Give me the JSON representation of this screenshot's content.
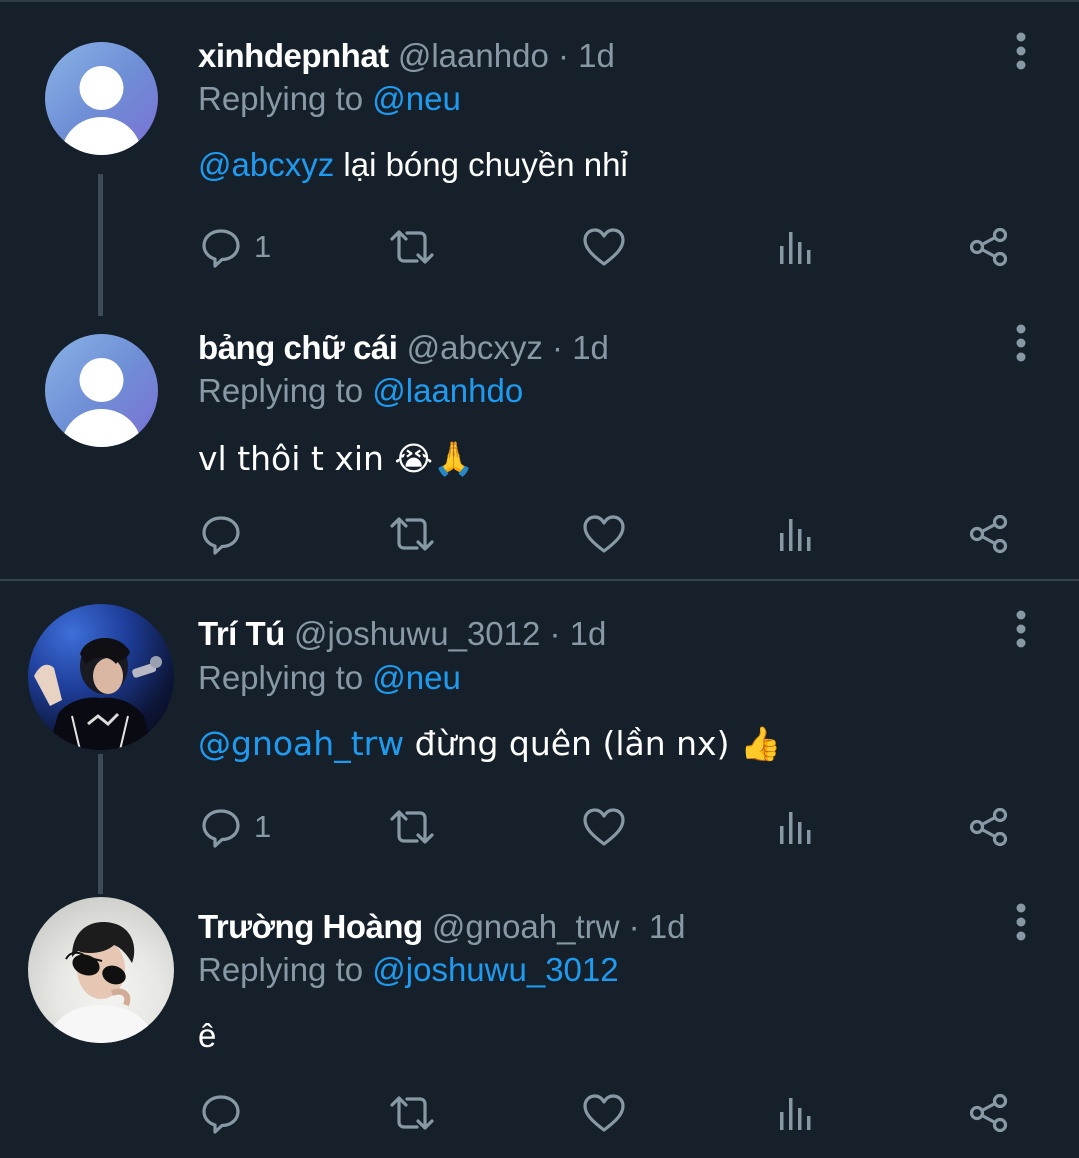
{
  "tweets": [
    {
      "name": "xinhdepnhat",
      "handle": "@laanhdo",
      "separator": "·",
      "time": "1d",
      "replying_prefix": "Replying to ",
      "replying_to": "@neu",
      "mention": "@abcxyz",
      "text": " lại bóng chuyền nhỉ",
      "reply_count": "1"
    },
    {
      "name": "bảng chữ cái",
      "handle": "@abcxyz",
      "separator": "·",
      "time": "1d",
      "replying_prefix": "Replying to ",
      "replying_to": "@laanhdo",
      "mention": "",
      "text": "vl thôi t xin 😭🙏",
      "reply_count": ""
    },
    {
      "name": "Trí Tú",
      "handle": "@joshuwu_3012",
      "separator": "·",
      "time": "1d",
      "replying_prefix": "Replying to ",
      "replying_to": "@neu",
      "mention": "@gnoah_trw",
      "text": " đừng quên (lần nx) 👍",
      "reply_count": "1"
    },
    {
      "name": "Trường Hoàng",
      "handle": "@gnoah_trw",
      "separator": "·",
      "time": "1d",
      "replying_prefix": "Replying to ",
      "replying_to": "@joshuwu_3012",
      "mention": "",
      "text": "ê",
      "reply_count": ""
    }
  ],
  "icons": {
    "reply": "speech-bubble-icon",
    "retweet": "retweet-icon",
    "like": "heart-icon",
    "analytics": "bar-chart-icon",
    "share": "share-icon",
    "more": "vertical-dots-icon"
  },
  "colors": {
    "background": "#15202b",
    "mention": "#1d9bf0",
    "secondary_text": "#8899a6",
    "divider": "#38444d"
  }
}
